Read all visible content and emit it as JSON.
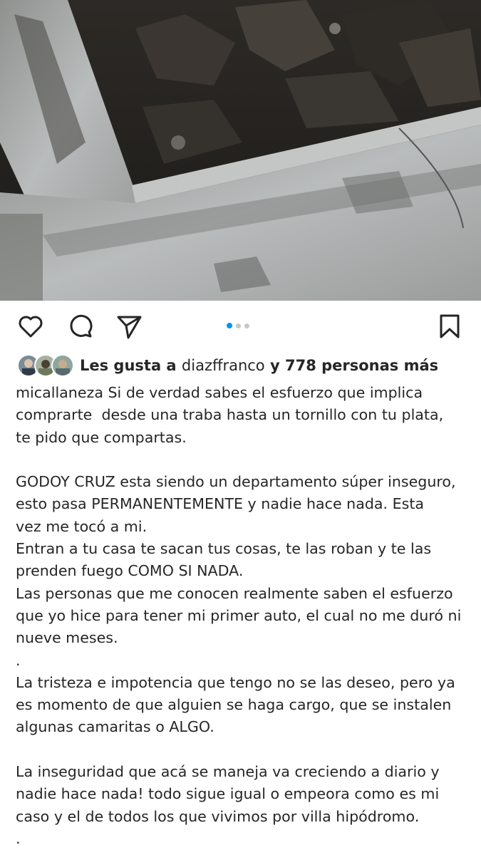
{
  "post": {
    "image_description_icon": "burned-car-photo",
    "carousel": {
      "total": 3,
      "active": 1
    },
    "actions": {
      "like_icon": "heart-icon",
      "comment_icon": "comment-icon",
      "share_icon": "send-icon",
      "save_icon": "bookmark-icon"
    },
    "likes": {
      "prefix": "Les gusta a ",
      "user": "diazffranco",
      "suffix": " y 778 personas más"
    },
    "caption": {
      "username": "micallaneza",
      "lines": [
        "micallaneza Si de verdad sabes el esfuerzo que implica",
        "comprarte  desde una traba hasta un tornillo con tu plata,",
        "te pido que compartas.",
        "",
        "GODOY CRUZ esta siendo un departamento súper inseguro,",
        "esto pasa PERMANENTEMENTE y nadie hace nada. Esta",
        "vez me tocó a mi.",
        "Entran a tu casa te sacan tus cosas, te las roban y te las",
        "prenden fuego COMO SI NADA.",
        "Las personas que me conocen realmente saben el esfuerzo",
        "que yo hice para tener mi primer auto, el cual no me duró ni",
        "nueve meses.",
        ".",
        "La tristeza e impotencia que tengo no se las deseo, pero ya",
        "es momento de que alguien se haga cargo, que se instalen",
        "algunas camaritas o ALGO.",
        "",
        "La inseguridad que acá se maneja va creciendo a diario y",
        "nadie hace nada! todo sigue igual o empeora como es mi",
        "caso y el de todos los que vivimos por villa hipódromo.",
        "."
      ]
    }
  }
}
